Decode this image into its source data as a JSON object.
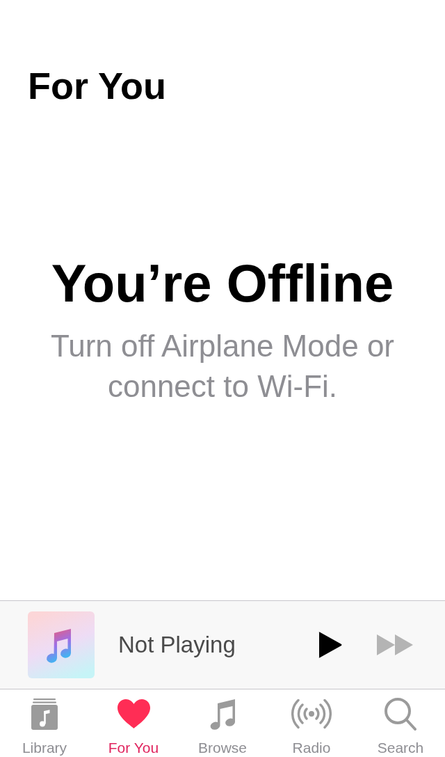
{
  "header": {
    "title": "For You"
  },
  "offline": {
    "title": "You’re Offline",
    "message": "Turn off Airplane Mode or connect to Wi-Fi."
  },
  "mini_player": {
    "title": "Not Playing",
    "controls": [
      {
        "kind": "play",
        "disabled": false
      },
      {
        "kind": "forward",
        "disabled": true
      }
    ]
  },
  "tabs": [
    {
      "kind": "library",
      "label": "Library",
      "selected": false
    },
    {
      "kind": "for_you",
      "label": "For You",
      "selected": true
    },
    {
      "kind": "browse",
      "label": "Browse",
      "selected": false
    },
    {
      "kind": "radio",
      "label": "Radio",
      "selected": false
    },
    {
      "kind": "search",
      "label": "Search",
      "selected": false
    }
  ]
}
